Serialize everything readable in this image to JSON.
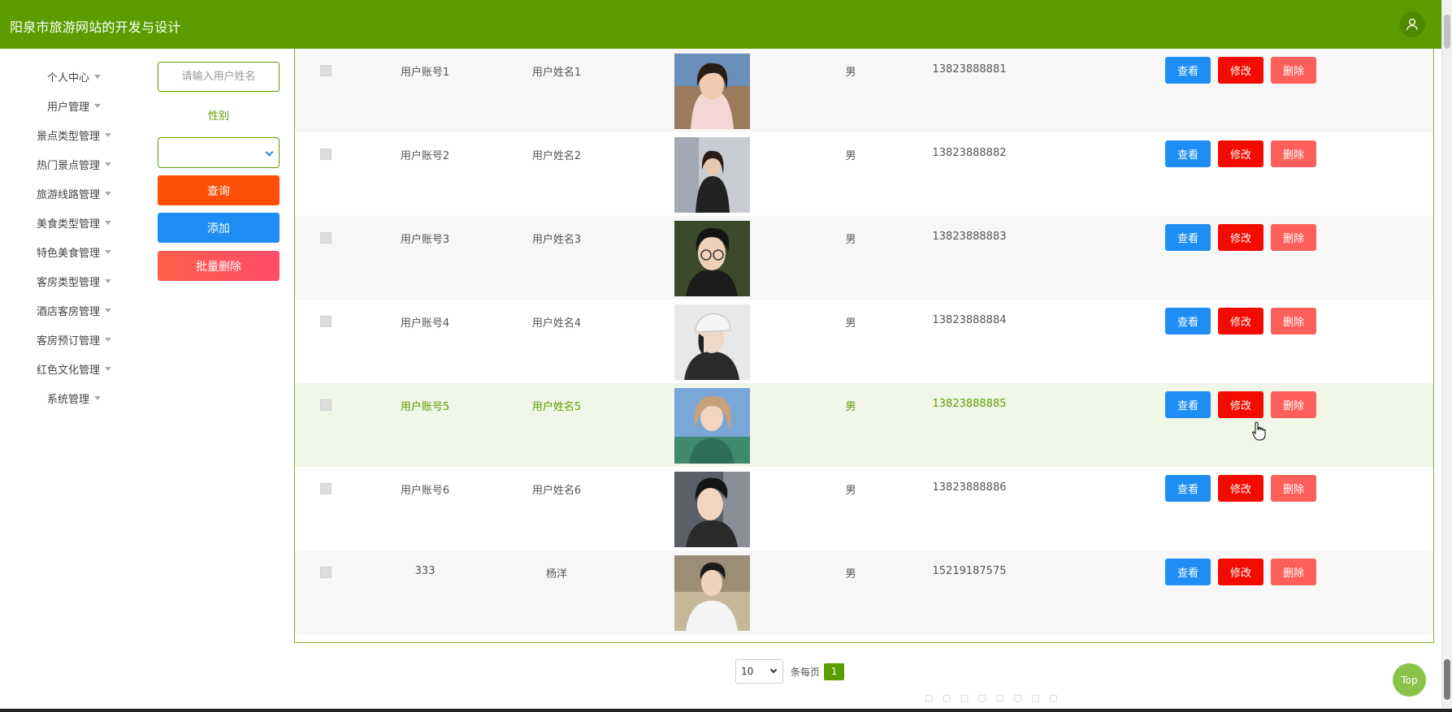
{
  "header": {
    "title": "阳泉市旅游网站的开发与设计",
    "user_icon": "user-icon"
  },
  "sidebar": {
    "items": [
      {
        "label": "个人中心"
      },
      {
        "label": "用户管理"
      },
      {
        "label": "景点类型管理"
      },
      {
        "label": "热门景点管理"
      },
      {
        "label": "旅游线路管理"
      },
      {
        "label": "美食类型管理"
      },
      {
        "label": "特色美食管理"
      },
      {
        "label": "客房类型管理"
      },
      {
        "label": "酒店客房管理"
      },
      {
        "label": "客房预订管理"
      },
      {
        "label": "红色文化管理"
      },
      {
        "label": "系统管理"
      }
    ]
  },
  "search": {
    "name_placeholder": "请输入用户姓名",
    "gender_label": "性别",
    "gender_value": "",
    "query_label": "查询",
    "add_label": "添加",
    "batch_delete_label": "批量删除"
  },
  "table": {
    "actions": {
      "view": "查看",
      "edit": "修改",
      "delete": "删除"
    },
    "rows": [
      {
        "account": "用户账号1",
        "name": "用户姓名1",
        "sex": "男",
        "phone": "13823888881",
        "photo": "photo-female-1"
      },
      {
        "account": "用户账号2",
        "name": "用户姓名2",
        "sex": "男",
        "phone": "13823888882",
        "photo": "photo-female-2"
      },
      {
        "account": "用户账号3",
        "name": "用户姓名3",
        "sex": "男",
        "phone": "13823888883",
        "photo": "photo-male-glasses"
      },
      {
        "account": "用户账号4",
        "name": "用户姓名4",
        "sex": "男",
        "phone": "13823888884",
        "photo": "photo-female-cap"
      },
      {
        "account": "用户账号5",
        "name": "用户姓名5",
        "sex": "男",
        "phone": "13823888885",
        "photo": "photo-female-3"
      },
      {
        "account": "用户账号6",
        "name": "用户姓名6",
        "sex": "男",
        "phone": "13823888886",
        "photo": "photo-male-2"
      },
      {
        "account": "333",
        "name": "杨洋",
        "sex": "男",
        "phone": "15219187575",
        "photo": "photo-male-3"
      }
    ]
  },
  "pagination": {
    "page_size": "10",
    "per_page_label": "条每页",
    "current_page": "1"
  },
  "top_button": {
    "label": "Top"
  },
  "colors": {
    "brand": "#5b9d00",
    "query": "#ff4f08",
    "add": "#1e8ef5",
    "edit": "#f40b00",
    "delete": "#ff5f5a"
  }
}
